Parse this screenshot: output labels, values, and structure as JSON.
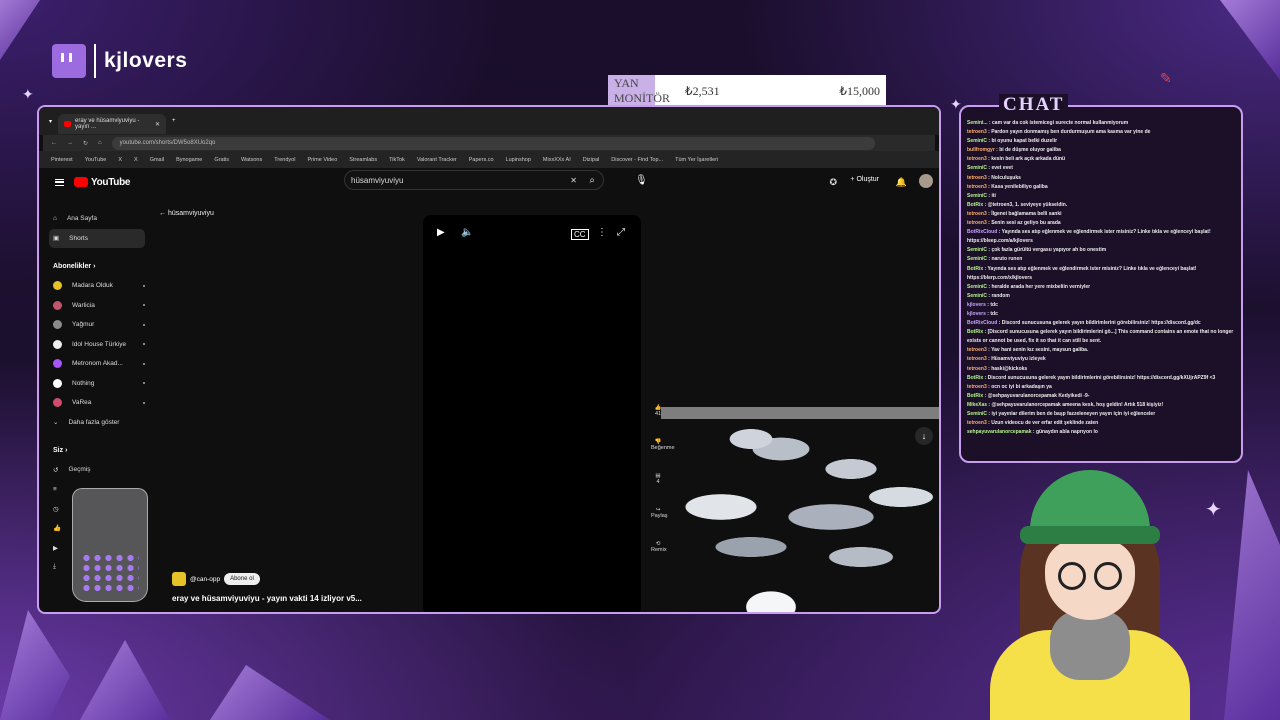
{
  "brand": {
    "name": "kjlovers"
  },
  "ticker": {
    "label": "YAN MONİTÖR",
    "current": "₺2,531",
    "target": "₺15,000",
    "progress": 0.169
  },
  "browser": {
    "tab_title": "eray ve hüsamviyuviyu - yayın ...",
    "url": "youtube.com/shorts/DW5o8XUo2qo",
    "bookmarks": [
      "Pinterest",
      "YouTube",
      "X",
      "X",
      "Gmail",
      "Bynogame",
      "Gratis",
      "Watsons",
      "Trendyol",
      "Prime Video",
      "Streamlabs",
      "TikTok",
      "Valorant Tracker",
      "Papers.co",
      "Lupinshop",
      "MixxXXx AI",
      "Dizipal",
      "Discover - Find Top...",
      "Tüm Yer İşaretleri"
    ]
  },
  "youtube": {
    "logo": "YouTube",
    "search_value": "hüsamviyuviyu",
    "create_label": "Oluştur",
    "back_label": "hüsamviyuviyu",
    "nav": [
      {
        "label": "Ana Sayfa"
      },
      {
        "label": "Shorts"
      }
    ],
    "subs_header": "Abonelikler",
    "subs": [
      {
        "label": "Madara Olduk",
        "color": "#e6c229"
      },
      {
        "label": "Warlicia",
        "color": "#c0566b"
      },
      {
        "label": "Yağmur",
        "color": "#8a8a8a"
      },
      {
        "label": "Idol House Türkiye",
        "color": "#eeeeee"
      },
      {
        "label": "Metronom Akad...",
        "color": "#a855f7"
      },
      {
        "label": "Nothing",
        "color": "#ffffff"
      },
      {
        "label": "VaRea",
        "color": "#d14b6a"
      }
    ],
    "show_more": "Daha fazla göster",
    "you_header": "Siz",
    "you_items": [
      {
        "label": "Geçmiş"
      },
      {
        "label": "Oynatma listeleri"
      },
      {
        "label": "Daha sonra izle"
      },
      {
        "label": "Beğenilen videolar"
      },
      {
        "label": "İndirilenler"
      }
    ],
    "channel": "@can-opp",
    "subscribe": "Abone ol",
    "video_title": "eray ve hüsamviyuviyu - yayın vakti 14 izliyor v5...",
    "actions": [
      {
        "label": "41"
      },
      {
        "label": "Beğenme"
      },
      {
        "label": "4"
      },
      {
        "label": "Paylaş"
      },
      {
        "label": "Remix"
      }
    ]
  },
  "chat": {
    "title": "CHAT",
    "messages": [
      {
        "user": "Semini...",
        "text": "cam var da cok istemicegi surecte normal kullanmiyorum",
        "c": "u"
      },
      {
        "user": "tetroen3",
        "text": "Pardon yayın donmamış ben durdurmuşum ama kasma var yine de",
        "c": "o"
      },
      {
        "user": "SeminiC",
        "text": "bi oyunu kapat belki duzelir",
        "c": "u"
      },
      {
        "user": "bullfromgyr",
        "text": "bi de düşme oluyor galiba",
        "c": "o"
      },
      {
        "user": "tetroen3",
        "text": "kesin beli ark açık arkada dünü",
        "c": "o"
      },
      {
        "user": "SeminiC",
        "text": "evet evet",
        "c": "u"
      },
      {
        "user": "tetroen3",
        "text": "Nolculuşuks",
        "c": "o"
      },
      {
        "user": "tetroen3",
        "text": "Kasa yenilebiliyo galiba",
        "c": "o"
      },
      {
        "user": "SeminiC",
        "text": "iti",
        "c": "u"
      },
      {
        "user": "BotRix",
        "text": "@tetroen3, 1. seviyeye yükseldin.",
        "c": "u"
      },
      {
        "user": "tetroen3",
        "text": "İlgenei bağlamama belli sanki",
        "c": "o"
      },
      {
        "user": "tetroen3",
        "text": "Senin sesi az geliyo bu arada",
        "c": "o"
      },
      {
        "user": "BotRixCloud",
        "text": "Yayında ses atıp eğlenmek ve eğlendirmek ister misiniz? Linke tıkla ve eğlenceyi başlat! https://bleep.com/a/kjlovers",
        "c": "p"
      },
      {
        "user": "SeminiC",
        "text": "çok fazla gürültü vergasu yapıyor ah bo onestim",
        "c": "u"
      },
      {
        "user": "SeminiC",
        "text": "naruto runen",
        "c": "u"
      },
      {
        "user": "BotRix",
        "text": "Yayında ses atıp eğlenmek ve eğlendirmek ister misiniz? Linke tıkla ve eğlenceyi başlat! https://blerp.com/x/kjlovers",
        "c": "u"
      },
      {
        "user": "SeminiC",
        "text": "heralde arada her yere mixbeliin verniyler",
        "c": "u"
      },
      {
        "user": "SeminiC",
        "text": "random",
        "c": "u"
      },
      {
        "user": "kjlovers",
        "text": "tdc",
        "c": "p"
      },
      {
        "user": "kjlovers",
        "text": "tdc",
        "c": "p"
      },
      {
        "user": "BotRixCloud",
        "text": "Discord sunucusuna gelerek yayın bildirimlerini görebilirsiniz! https://discord.gg/dc",
        "c": "p"
      },
      {
        "user": "BotRix",
        "text": "[Discord sunucusuna gelerek yayın bildirimlerini gö...] This command contains an emote that no longer exists or cannot be used, fix it so that it can still be sent.",
        "c": "u"
      },
      {
        "user": "tetroen3",
        "text": "Yav hani senin kız sesini, maysun galiba.",
        "c": "o"
      },
      {
        "user": "tetroen3",
        "text": "Hüsamviyuviyu izleyek",
        "c": "o"
      },
      {
        "user": "tetroen3",
        "text": "haski@kickoks",
        "c": "o"
      },
      {
        "user": "BotRix",
        "text": "Discord sunucusuna gelerek yayın bildirimlerini görebilirsiniz! https://discord.gg/kXUjrAPZ9f <3",
        "c": "u"
      },
      {
        "user": "tetroen3",
        "text": "ocn oc iyi bi arkadaşın ya",
        "c": "o"
      },
      {
        "user": "BotRix",
        "text": "@sehpayuvarulanorcepamak Kedyikedi -9-",
        "c": "u"
      },
      {
        "user": "MikeXas",
        "text": "@sehpayuvarulanorcepamak ameena kesk, hoş geldin! Artık 518 kişiyiz!",
        "c": "u"
      },
      {
        "user": "SeminiC",
        "text": "iyi yayınlar dilerim ben de başp fazzeleneyen yayın için iyi eğlenceler",
        "c": "u"
      },
      {
        "user": "tetroen3",
        "text": "Uzun videocu de ver erfar edit şeklinde zaten",
        "c": "o"
      },
      {
        "user": "sehpayuvarulanorcepamak",
        "text": "günaydın abla naprıyon lo",
        "c": "u"
      }
    ]
  },
  "colors": {
    "accent": "#c89df0",
    "twitch": "#9d6be0",
    "yt_red": "#ff0000"
  },
  "icons": [
    "twitch-icon",
    "menu-icon",
    "search-icon",
    "mic-icon",
    "bell-icon",
    "play-icon",
    "volume-icon",
    "cc-icon",
    "more-icon",
    "fullscreen-icon",
    "like-icon",
    "dislike-icon",
    "comment-icon",
    "share-icon",
    "remix-icon",
    "arrow-down-icon",
    "back-icon"
  ]
}
